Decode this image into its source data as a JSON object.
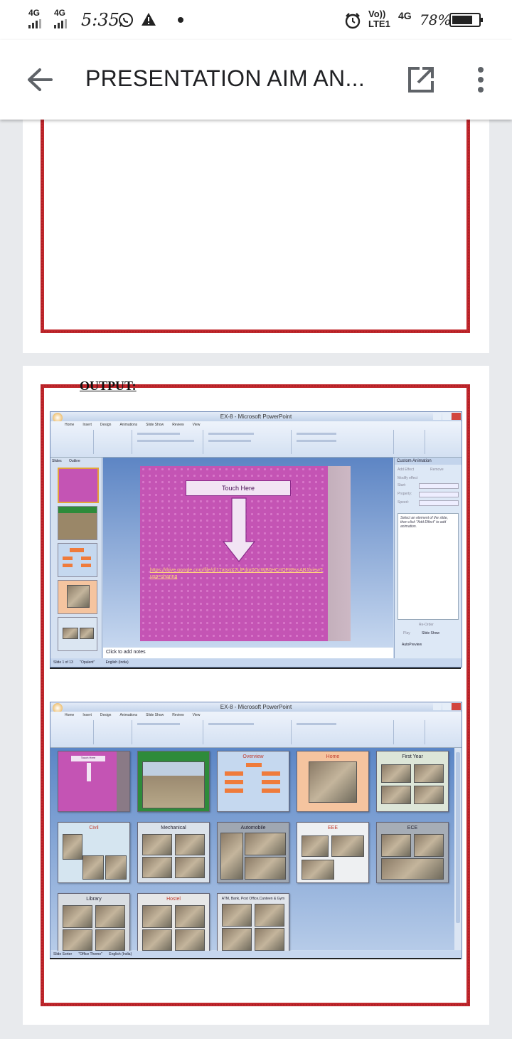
{
  "status_bar": {
    "network1": "4G",
    "network2": "4G",
    "time": "5:35",
    "volte": "Vo))",
    "lte": "LTE1",
    "network3": "4G",
    "battery": "78%",
    "battery_level": 0.78
  },
  "app_bar": {
    "title": "PRESENTATION AIM AN..."
  },
  "page2": {
    "heading": "OUTPUT:",
    "ppt1": {
      "window_title": "EX-8 - Microsoft PowerPoint",
      "tabs": [
        "Home",
        "Insert",
        "Design",
        "Animations",
        "Slide Show",
        "Review",
        "View"
      ],
      "panel_tabs": [
        "Slides",
        "Outline"
      ],
      "slide_button": "Touch Here",
      "slide_link": "https://drive.google.com/file/d/17aIsqX2LlPdgr0OcWB0HCrtQE89ssABJ/view?usp=sharing",
      "notes_placeholder": "Click to add notes",
      "pane_title": "Custom Animation",
      "pane_add": "Add Effect",
      "pane_remove": "Remove",
      "pane_modify": "Modify effect",
      "pane_fields": [
        "Start:",
        "Property:",
        "Speed:"
      ],
      "pane_hint": "Select an element of the slide, then click \"Add Effect\" to add animation.",
      "pane_reorder": "Re-Order",
      "pane_play": "Play",
      "pane_slideshow": "Slide Show",
      "pane_autopreview": "AutoPreview",
      "status_slide": "Slide 1 of 13",
      "status_theme": "\"Opulent\"",
      "status_lang": "English (India)"
    },
    "ppt2": {
      "window_title": "EX-8 - Microsoft PowerPoint",
      "tabs": [
        "Home",
        "Insert",
        "Design",
        "Animations",
        "Slide Show",
        "Review",
        "View"
      ],
      "slide_titles": [
        "Touch Here",
        "",
        "Overview",
        "Home",
        "First Year",
        "Civil",
        "Mechanical",
        "Automobile",
        "EEE",
        "ECE",
        "Library",
        "Hostel",
        "ATM, Bank, Post Office,Canteen & Gym"
      ],
      "status_view": "Slide Sorter",
      "status_theme": "\"Office Theme\"",
      "status_lang": "English (India)"
    }
  }
}
